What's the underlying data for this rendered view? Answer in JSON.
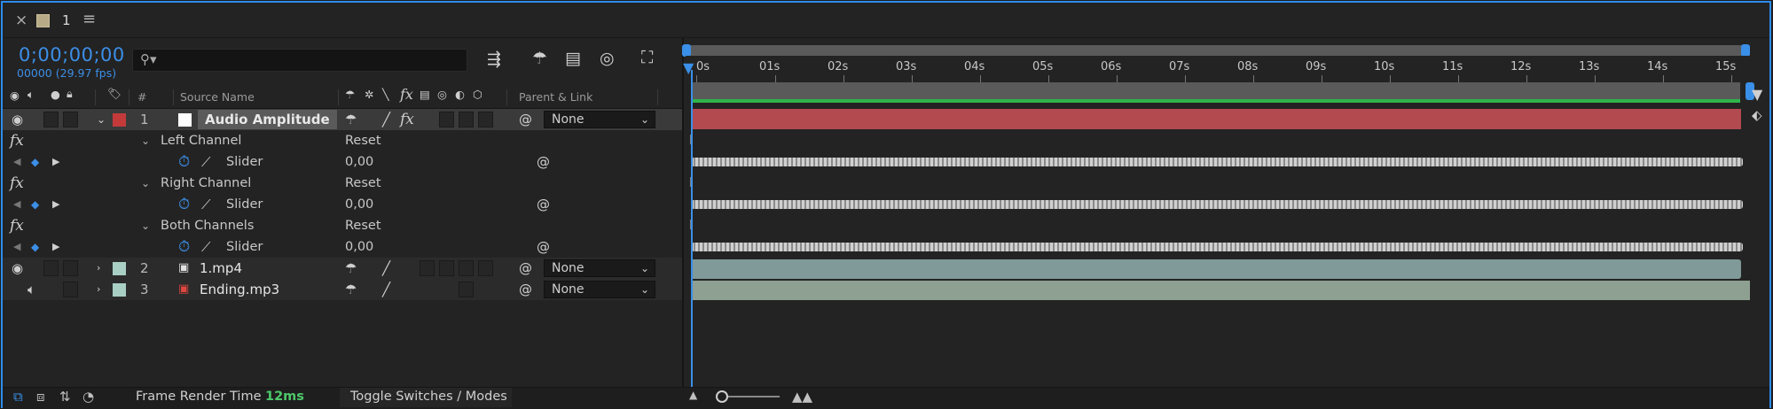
{
  "tab": {
    "title": "1",
    "close_icon": "close-icon",
    "menu_icon": "menu-icon",
    "swatch_color": "#b7aa86"
  },
  "header": {
    "timecode": "0;00;00;00",
    "fps_label": "00000 (29.97 fps)",
    "search_placeholder": "",
    "icons": [
      "comp-flowchart-icon",
      "draft-3d-icon",
      "frame-blending-icon",
      "motion-blur-icon",
      "graph-editor-icon"
    ]
  },
  "columns": {
    "label_icon": "tag-icon",
    "number": "#",
    "source_name": "Source Name",
    "parent_link": "Parent & Link"
  },
  "layers": [
    {
      "number": "1",
      "name": "Audio Amplitude",
      "label_color": "#c43a3a",
      "selected": true,
      "parent": "None",
      "effects": [
        {
          "name": "Left Channel",
          "reset": "Reset",
          "property": "Slider",
          "value": "0,00"
        },
        {
          "name": "Right Channel",
          "reset": "Reset",
          "property": "Slider",
          "value": "0,00"
        },
        {
          "name": "Both Channels",
          "reset": "Reset",
          "property": "Slider",
          "value": "0,00"
        }
      ]
    },
    {
      "number": "2",
      "name": "1.mp4",
      "label_color": "#a9cfc4",
      "parent": "None"
    },
    {
      "number": "3",
      "name": "Ending.mp3",
      "label_color": "#a9cfc4",
      "parent": "None"
    }
  ],
  "ruler": {
    "labels": [
      "0s",
      "01s",
      "02s",
      "03s",
      "04s",
      "05s",
      "06s",
      "07s",
      "08s",
      "09s",
      "10s",
      "11s",
      "12s",
      "13s",
      "14s",
      "15s"
    ]
  },
  "colors": {
    "accent": "#3c8ee6",
    "work_area": "#2fb54a",
    "layer1_bar": "#b24a50",
    "layer2_bar": "#7f9a99",
    "layer3_bar": "#8ea091"
  },
  "footer": {
    "frame_render_label": "Frame Render Time",
    "frame_render_value": "12ms",
    "toggle_label": "Toggle Switches / Modes"
  }
}
